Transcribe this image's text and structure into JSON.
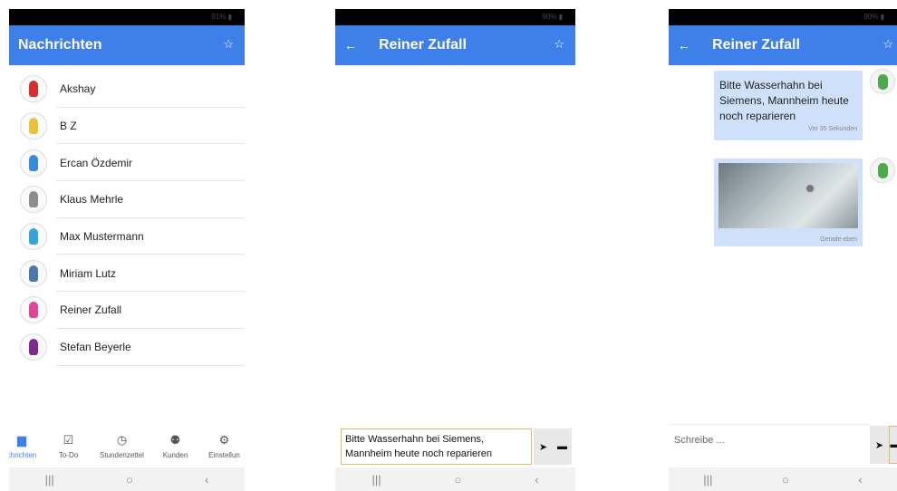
{
  "phone1": {
    "status": "91% ▮",
    "title": "Nachrichten",
    "contacts": [
      {
        "name": "Akshay",
        "color": "#d32f2f"
      },
      {
        "name": "B Z",
        "color": "#e8c43a"
      },
      {
        "name": "Ercan Özdemir",
        "color": "#3b8ad8"
      },
      {
        "name": "Klaus Mehrle",
        "color": "#8e8e8e"
      },
      {
        "name": "Max Mustermann",
        "color": "#35a4d8"
      },
      {
        "name": "Miriam Lutz",
        "color": "#4a78a8"
      },
      {
        "name": "Reiner Zufall",
        "color": "#e0459a"
      },
      {
        "name": "Stefan Beyerle",
        "color": "#7b2d8e"
      }
    ],
    "nav": [
      {
        "label": "chrichten",
        "icon": "chat-icon"
      },
      {
        "label": "To-Do",
        "icon": "checkbox-icon"
      },
      {
        "label": "Stundenzettel",
        "icon": "timer-icon"
      },
      {
        "label": "Kunden",
        "icon": "people-icon"
      },
      {
        "label": "Einstellun",
        "icon": "gear-icon"
      }
    ]
  },
  "phone2": {
    "status": "90% ▮",
    "title": "Reiner Zufall",
    "draft": "Bitte Wasserhahn bei Siemens, Mannheim heute noch reparieren"
  },
  "phone3": {
    "status": "90% ▮",
    "title": "Reiner Zufall",
    "msg1_text": "Bitte Wasserhahn bei Siemens, Mannheim heute noch reparieren",
    "msg1_time": "Vor 35 Sekunden",
    "msg2_time": "Gerade eben",
    "input_placeholder": "Schreibe ..."
  },
  "colors": {
    "accent": "#3f7fe9",
    "bubble": "#cfe0fb"
  }
}
